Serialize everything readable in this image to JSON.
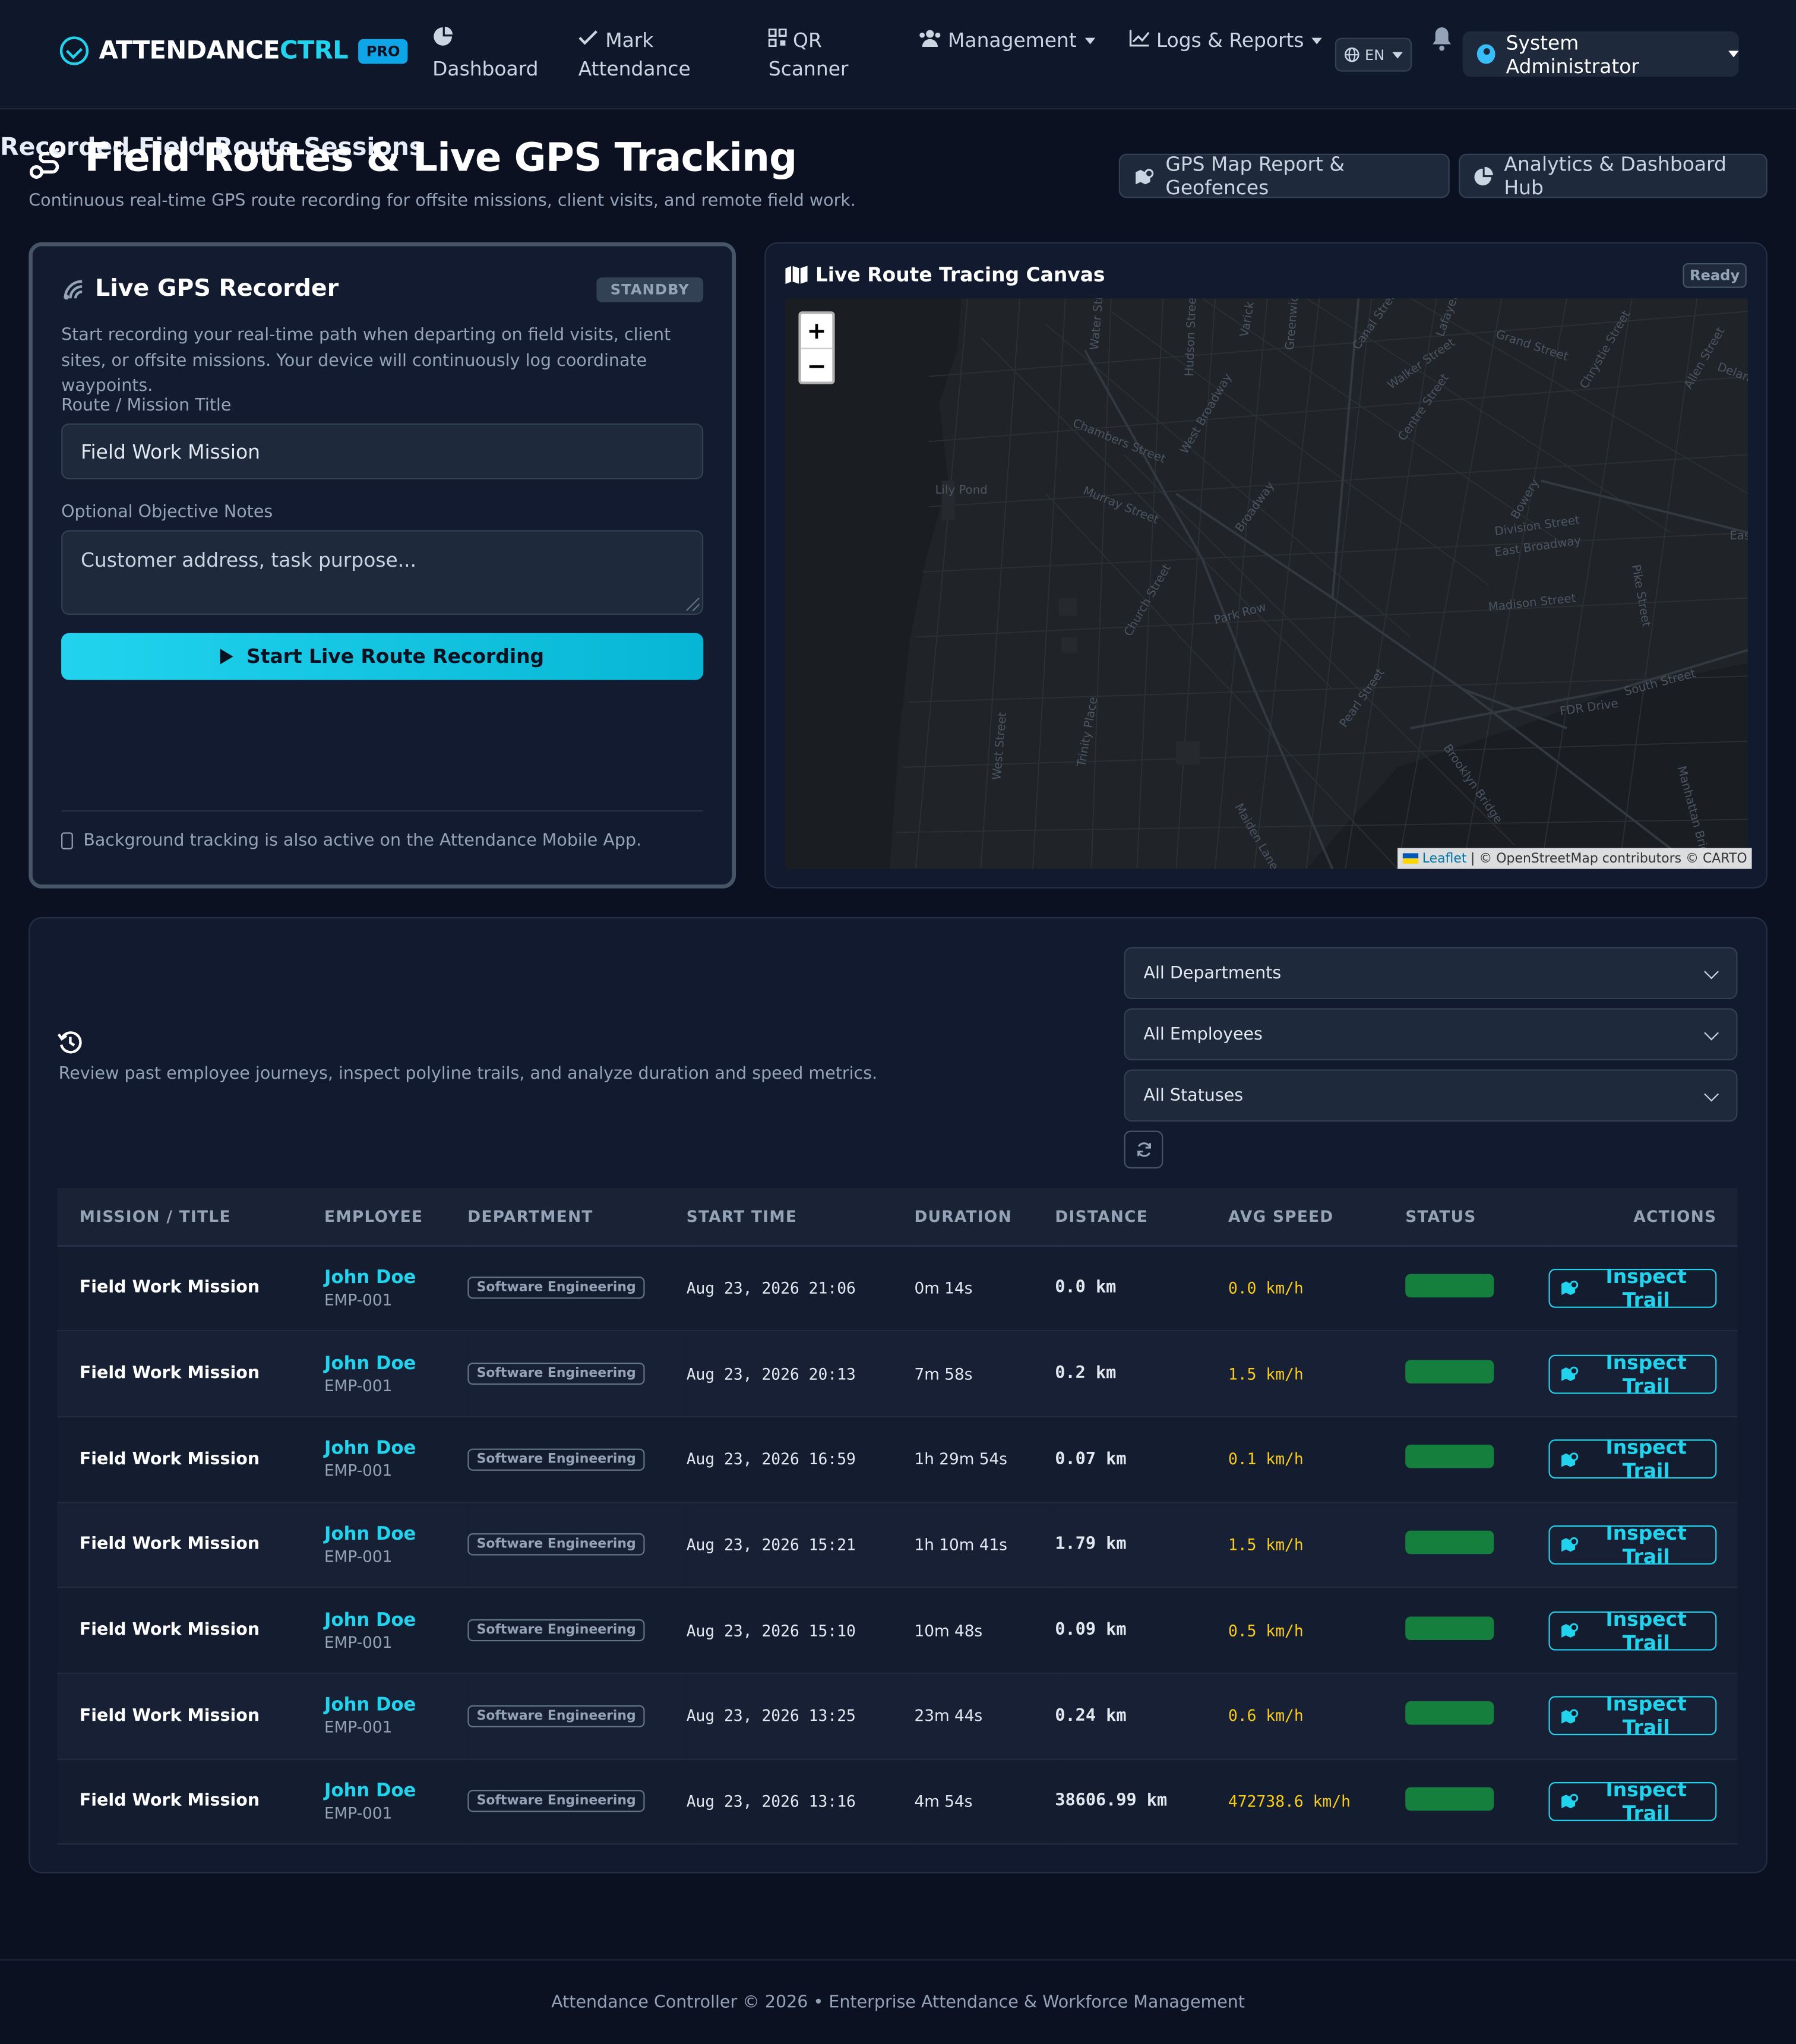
{
  "brand": {
    "name_main": "ATTENDANCE",
    "name_accent": "CTRL",
    "badge": "PRO"
  },
  "nav": {
    "dashboard": "Dashboard",
    "mark_attendance_1": "Mark",
    "mark_attendance_2": "Attendance",
    "qr_1": "QR",
    "qr_2": "Scanner",
    "management": "Management",
    "logs": "Logs & Reports",
    "lang": "EN",
    "user": "System Administrator"
  },
  "header": {
    "title": "Field Routes & Live GPS Tracking",
    "subtitle": "Continuous real-time GPS route recording for offsite missions, client visits, and remote field work.",
    "btn_gps": "GPS Map Report & Geofences",
    "btn_analytics": "Analytics & Dashboard Hub"
  },
  "recorder": {
    "title": "Live GPS Recorder",
    "status": "STANDBY",
    "description": "Start recording your real-time path when departing on field visits, client sites, or offsite missions. Your device will continuously log coordinate waypoints.",
    "route_label": "Route / Mission Title",
    "route_value": "Field Work Mission",
    "notes_label": "Optional Objective Notes",
    "notes_placeholder": "Customer address, task purpose...",
    "start_button": "Start Live Route Recording",
    "footer_note": "Background tracking is also active on the Attendance Mobile App."
  },
  "map": {
    "title": "Live Route Tracing Canvas",
    "status": "Ready",
    "zoom_in": "+",
    "zoom_out": "−",
    "attrib_leaflet": "Leaflet",
    "attrib_rest": "| © OpenStreetMap contributors © CARTO",
    "labels": [
      "Chambers Street",
      "Murray Street",
      "Church Street",
      "West Broadway",
      "Broadway",
      "Park Row",
      "Canal Street",
      "Walker Street",
      "Grand Street",
      "Chrystie Street",
      "Division Street",
      "East Broadway",
      "Madison Street",
      "Pike Street",
      "FDR Drive",
      "South Street",
      "Pearl Street",
      "Brooklyn Bridge",
      "Manhattan Bridge",
      "Hudson Street",
      "West Street",
      "Trinity Place",
      "Water Street",
      "Centre Street",
      "Lafayette Street",
      "Allen Street",
      "Bowery",
      "Lily Pond",
      "Delancey",
      "Varick",
      "Greenwich",
      "Maiden Lane",
      "East"
    ]
  },
  "sessions": {
    "title": "Recorded Field Route Sessions",
    "subtitle": "Review past employee journeys, inspect polyline trails, and analyze duration and speed metrics.",
    "filters": {
      "departments": "All Departments",
      "employees": "All Employees",
      "statuses": "All Statuses"
    },
    "columns": {
      "mission": "MISSION / TITLE",
      "employee": "EMPLOYEE",
      "department": "DEPARTMENT",
      "start": "START TIME",
      "duration": "DURATION",
      "distance": "DISTANCE",
      "speed": "AVG SPEED",
      "status": "STATUS",
      "actions": "ACTIONS"
    },
    "speed_unit": "km/h",
    "action_label": "Inspect Trail",
    "rows": [
      {
        "title": "Field Work Mission",
        "employee": "John Doe",
        "emp_id": "EMP-001",
        "department": "Software Engineering",
        "start": "Aug 23, 2026 21:06",
        "duration": "0m 14s",
        "distance": "0.0 km",
        "speed": "0.0 km/h"
      },
      {
        "title": "Field Work Mission",
        "employee": "John Doe",
        "emp_id": "EMP-001",
        "department": "Software Engineering",
        "start": "Aug 23, 2026 20:13",
        "duration": "7m 58s",
        "distance": "0.2 km",
        "speed": "1.5 km/h"
      },
      {
        "title": "Field Work Mission",
        "employee": "John Doe",
        "emp_id": "EMP-001",
        "department": "Software Engineering",
        "start": "Aug 23, 2026 16:59",
        "duration": "1h 29m 54s",
        "distance": "0.07 km",
        "speed": "0.1 km/h"
      },
      {
        "title": "Field Work Mission",
        "employee": "John Doe",
        "emp_id": "EMP-001",
        "department": "Software Engineering",
        "start": "Aug 23, 2026 15:21",
        "duration": "1h 10m 41s",
        "distance": "1.79 km",
        "speed": "1.5 km/h"
      },
      {
        "title": "Field Work Mission",
        "employee": "John Doe",
        "emp_id": "EMP-001",
        "department": "Software Engineering",
        "start": "Aug 23, 2026 15:10",
        "duration": "10m 48s",
        "distance": "0.09 km",
        "speed": "0.5 km/h"
      },
      {
        "title": "Field Work Mission",
        "employee": "John Doe",
        "emp_id": "EMP-001",
        "department": "Software Engineering",
        "start": "Aug 23, 2026 13:25",
        "duration": "23m 44s",
        "distance": "0.24 km",
        "speed": "0.6 km/h"
      },
      {
        "title": "Field Work Mission",
        "employee": "John Doe",
        "emp_id": "EMP-001",
        "department": "Software Engineering",
        "start": "Aug 23, 2026 13:16",
        "duration": "4m 54s",
        "distance": "38606.99 km",
        "speed": "472738.6 km/h"
      }
    ]
  },
  "footer": {
    "text": "Attendance Controller © 2026 • Enterprise Attendance & Workforce Management"
  },
  "colors": {
    "accent": "#22d3ee",
    "status_ok": "#15803d",
    "speed": "#facc15",
    "bg": "#0b1120"
  }
}
